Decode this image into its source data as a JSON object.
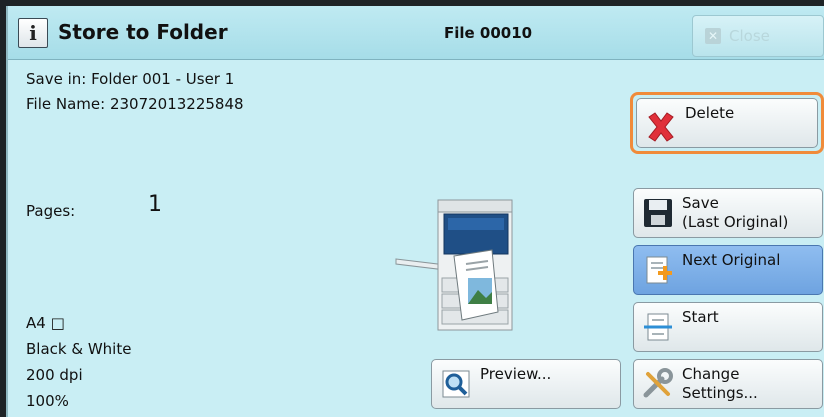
{
  "header": {
    "title": "Store to Folder",
    "info_icon_glyph": "i",
    "file_id": "File 00010",
    "close_label": "Close"
  },
  "info": {
    "save_in": "Save in: Folder 001 - User 1",
    "file_name": "File Name: 23072013225848",
    "pages_label": "Pages:",
    "pages_value": "1",
    "paper_size": "A4 □",
    "color_mode": "Black & White",
    "resolution": "200 dpi",
    "zoom": "100%"
  },
  "buttons": {
    "delete": "Delete",
    "save": "Save\n(Last Original)",
    "next_original": "Next Original",
    "start": "Start",
    "change_settings": "Change\nSettings...",
    "preview": "Preview..."
  },
  "colors": {
    "panel_bg": "#c9eef4",
    "highlight_orange": "#f08b3a",
    "selected_blue": "#7aaee6"
  }
}
